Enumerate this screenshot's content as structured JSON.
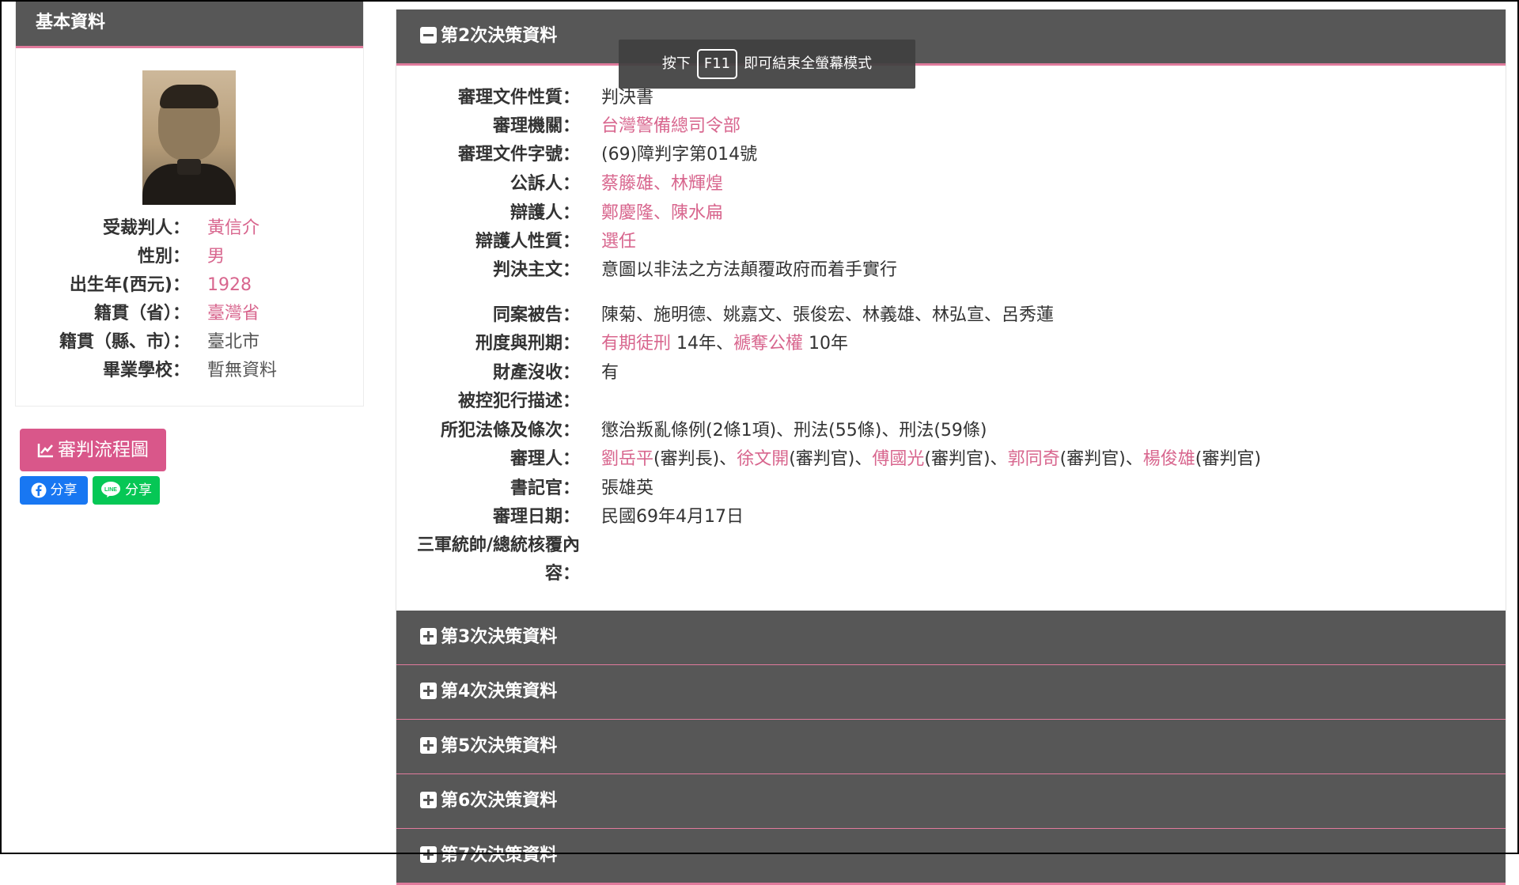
{
  "left": {
    "header": "基本資料",
    "rows": [
      {
        "label": "受裁判人：",
        "value": "黃信介",
        "style": "pink"
      },
      {
        "label": "性別：",
        "value": "男",
        "style": "pink"
      },
      {
        "label": "出生年(西元)：",
        "value": "1928",
        "style": "pink"
      },
      {
        "label": "籍貫（省）：",
        "value": "臺灣省",
        "style": "pink"
      },
      {
        "label": "籍貫（縣、市）：",
        "value": "臺北市",
        "style": "grey"
      },
      {
        "label": "畢業學校：",
        "value": "暫無資料",
        "style": "grey"
      }
    ],
    "flow_button": "審判流程圖",
    "share_fb": "分享",
    "share_line": "分享"
  },
  "section_open": {
    "title": "第2次決策資料",
    "rows": [
      {
        "label": "審理文件性質：",
        "value": "判決書"
      },
      {
        "label": "審理機關：",
        "value": "台灣警備總司令部"
      },
      {
        "label": "審理文件字號：",
        "value": "(69)障判字第014號"
      },
      {
        "label": "公訴人：",
        "value": "蔡籐雄、林輝煌"
      },
      {
        "label": "辯護人：",
        "value": "鄭慶隆、陳水扁"
      },
      {
        "label": "辯護人性質：",
        "value": "選任"
      },
      {
        "label": "判決主文：",
        "value": "意圖以非法之方法顛覆政府而着手實行"
      },
      {
        "label": "同案被告：",
        "value": "陳菊、施明德、姚嘉文、張俊宏、林義雄、林弘宣、呂秀蓮"
      },
      {
        "label": "刑度與刑期：",
        "value_parts": [
          "有期徒刑",
          " 14年、",
          "褫奪公權",
          " 10年"
        ]
      },
      {
        "label": "財產沒收：",
        "value": "有"
      },
      {
        "label": "被控犯行描述：",
        "value": ""
      },
      {
        "label": "所犯法條及條次：",
        "value": "懲治叛亂條例(2條1項)、刑法(55條)、刑法(59條)"
      },
      {
        "label": "審理人：",
        "value_parts": [
          "劉岳平",
          "(審判長)、",
          "徐文開",
          "(審判官)、",
          "傅國光",
          "(審判官)、",
          "郭同奇",
          "(審判官)、",
          "楊俊雄",
          "(審判官)"
        ]
      },
      {
        "label": "書記官：",
        "value": "張雄英"
      },
      {
        "label": "審理日期：",
        "value": "民國69年4月17日"
      },
      {
        "label_line1": "三軍統帥/總統核覆內",
        "label_line2": "容：",
        "value": ""
      }
    ]
  },
  "sections_collapsed": [
    "第3次決策資料",
    "第4次決策資料",
    "第5次決策資料",
    "第6次決策資料",
    "第7次決策資料"
  ],
  "toast": {
    "before": "按下",
    "key": "F11",
    "after": "即可結束全螢幕模式"
  },
  "colors": {
    "header_bg": "#575757",
    "accent_pink": "#d8668e",
    "underline_pink": "#e07a9c",
    "button_pink": "#d9578a",
    "facebook": "#1877f2",
    "line": "#06c755"
  }
}
